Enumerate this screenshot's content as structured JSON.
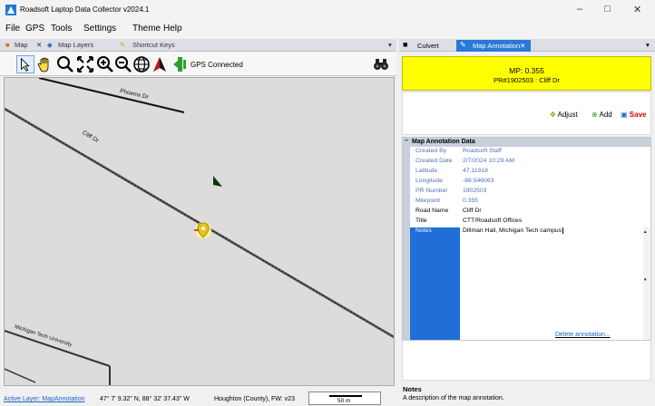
{
  "app": {
    "title": "Roadsoft Laptop Data Collector v2024.1"
  },
  "menu": [
    "File",
    "GPS",
    "Tools",
    "Settings",
    "Theme",
    "Help"
  ],
  "left_tabs": {
    "map": "Map",
    "map_layers": "Map Layers",
    "shortcut_keys": "Shortcut Keys"
  },
  "toolbar": {
    "gps_status": "GPS Connected"
  },
  "map": {
    "streets": [
      "Phoenix Dr",
      "Cliff Dr",
      "Michigan Tech University"
    ]
  },
  "status": {
    "active_layer": "Active Layer: MapAnnotation",
    "coords": "47° 7' 9.32\" N, 88° 32' 37.43\" W",
    "county": "Houghton (County), FW: v23",
    "scale": "50 m"
  },
  "right_tabs": {
    "culvert": "Culvert",
    "map_annotation": "Map Annotation"
  },
  "header": {
    "mp": "MP: 0.355",
    "pr": "PR#1902503 : Cliff Dr"
  },
  "actions": {
    "adjust": "Adjust",
    "add": "Add",
    "save": "Save"
  },
  "grid": {
    "section": "Map Annotation Data",
    "rows": [
      {
        "k": "Created By",
        "v": "Roadsoft Staff"
      },
      {
        "k": "Created Date",
        "v": "2/7/2024 10:29 AM"
      },
      {
        "k": "Latitude",
        "v": "47.11918"
      },
      {
        "k": "Longitude",
        "v": "-88.546063"
      },
      {
        "k": "PR Number",
        "v": "1902503"
      },
      {
        "k": "Milepoint",
        "v": "0.355"
      },
      {
        "k": "Road Name",
        "v": "Cliff Dr"
      },
      {
        "k": "Title",
        "v": "CTT/Roadsoft Offices"
      }
    ],
    "notes_label": "Notes",
    "notes_value": "Dillman Hall, Michigan Tech campus",
    "delete_link": "Delete annotation..."
  },
  "help": {
    "title": "Notes",
    "text": "A description of the map annotation."
  },
  "colors": {
    "accent": "#2b79d6",
    "highlight": "#ffff00",
    "save": "#d60000"
  }
}
